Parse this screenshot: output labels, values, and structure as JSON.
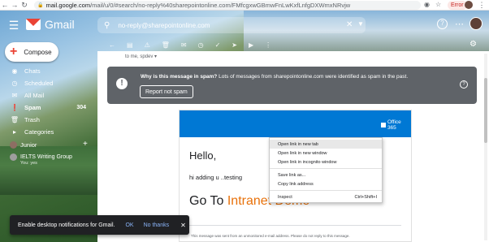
{
  "browser": {
    "url_host": "mail.google.com",
    "url_path": "/mail/u/0/#search/no-reply%40sharepointonline.com/FMfcgxwGBmwFnLwKxfLnfgDXWmxNRvjw",
    "error_label": "Error"
  },
  "gmail": {
    "app_name": "Gmail",
    "search_query": "no-reply@sharepointonline.com",
    "colors": {
      "accent": "#ea4335",
      "banner": "#5f6368",
      "o365_blue": "#0078d4",
      "link_orange": "#e8710a"
    }
  },
  "sidebar": {
    "compose_label": "Compose",
    "items": [
      {
        "label": "Chats",
        "icon": "chat-icon",
        "count": ""
      },
      {
        "label": "Scheduled",
        "icon": "clock-icon",
        "count": ""
      },
      {
        "label": "All Mail",
        "icon": "mail-icon",
        "count": ""
      },
      {
        "label": "Spam",
        "icon": "warning-icon",
        "count": "304"
      },
      {
        "label": "Trash",
        "icon": "trash-icon",
        "count": ""
      },
      {
        "label": "Categories",
        "icon": "tag-icon",
        "count": ""
      }
    ],
    "hangouts_user": "Junior",
    "group_name": "IELTS Writing Group",
    "group_sub": "You: yes"
  },
  "message": {
    "to_line": "to me, spdev",
    "spam_banner": {
      "bold": "Why is this message in spam?",
      "text": "Lots of messages from sharepointonline.com were identified as spam in the past.",
      "button": "Report not spam"
    },
    "email": {
      "logo_text": "Office 365",
      "greeting": "Hello,",
      "body": "hi adding u ..testing",
      "goto_prefix": "Go To ",
      "goto_link": "Intranet Demo",
      "footer": "This message was sent from an unmonitored e-mail address. Please do not reply to this message."
    }
  },
  "context_menu": {
    "items": [
      {
        "label": "Open link in new tab",
        "shortcut": ""
      },
      {
        "label": "Open link in new window",
        "shortcut": ""
      },
      {
        "label": "Open link in incognito window",
        "shortcut": ""
      },
      {
        "label": "Save link as...",
        "shortcut": ""
      },
      {
        "label": "Copy link address",
        "shortcut": ""
      },
      {
        "label": "Inspect",
        "shortcut": "Ctrl+Shift+I"
      }
    ]
  },
  "snackbar": {
    "message": "Enable desktop notifications for Gmail.",
    "ok": "OK",
    "no_thanks": "No thanks"
  }
}
